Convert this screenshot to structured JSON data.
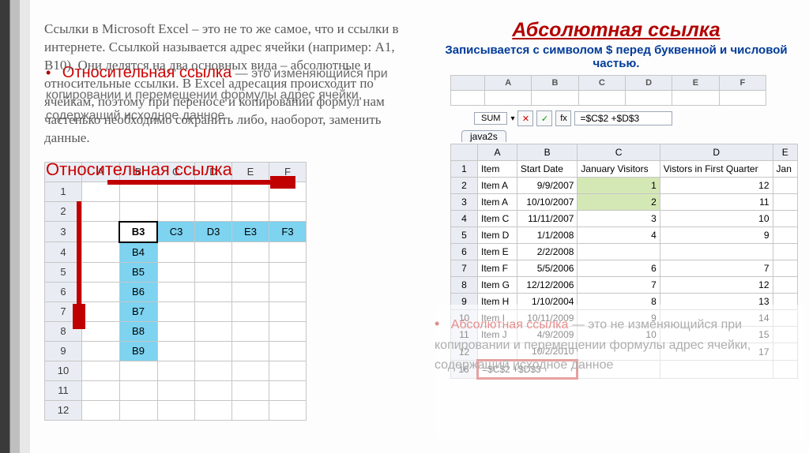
{
  "left": {
    "paragraph": "Ссылки в Microsoft Excel – это не то же самое, что и ссылки в интернете. Ссылкой называется адрес ячейки (например: А1, В10). Они делятся на два основных вида – абсолютные и относительные ссылки. В Excel адресация происходит по ячейкам, поэтому при переносе и копировании формул нам частенько необходимо сохранить либо, наоборот, заменить данные.",
    "ghost_heading": "Относительная ссылка",
    "ghost_item_title": "Относительная ссылка",
    "ghost_body": " — это изменяющийся при копировании и перемещении формулы адрес ячейки, содержащий исходное данное",
    "table": {
      "cols": [
        "",
        "A",
        "B",
        "C",
        "D",
        "E",
        "F"
      ],
      "rows": [
        {
          "n": "1",
          "cells": [
            "",
            "",
            "",
            "",
            "",
            ""
          ]
        },
        {
          "n": "2",
          "cells": [
            "",
            "",
            "",
            "",
            "",
            ""
          ]
        },
        {
          "n": "3",
          "cells": [
            "",
            "B3",
            "C3",
            "D3",
            "E3",
            "F3"
          ]
        },
        {
          "n": "4",
          "cells": [
            "",
            "B4",
            "",
            "",
            "",
            ""
          ]
        },
        {
          "n": "5",
          "cells": [
            "",
            "B5",
            "",
            "",
            "",
            ""
          ]
        },
        {
          "n": "6",
          "cells": [
            "",
            "B6",
            "",
            "",
            "",
            ""
          ]
        },
        {
          "n": "7",
          "cells": [
            "",
            "B7",
            "",
            "",
            "",
            ""
          ]
        },
        {
          "n": "8",
          "cells": [
            "",
            "B8",
            "",
            "",
            "",
            ""
          ]
        },
        {
          "n": "9",
          "cells": [
            "",
            "B9",
            "",
            "",
            "",
            ""
          ]
        },
        {
          "n": "10",
          "cells": [
            "",
            "",
            "",
            "",
            "",
            ""
          ]
        },
        {
          "n": "11",
          "cells": [
            "",
            "",
            "",
            "",
            "",
            ""
          ]
        },
        {
          "n": "12",
          "cells": [
            "",
            "",
            "",
            "",
            "",
            ""
          ]
        }
      ]
    }
  },
  "right": {
    "title": "Абсолютная ссылка",
    "subtitle": "Записывается с символом $ перед буквенной и числовой частью.",
    "mini_cols": [
      "",
      "A",
      "B",
      "C",
      "D",
      "E",
      "F"
    ],
    "namebox": "SUM",
    "fx_label": "fx",
    "formula": "=$C$2 +$D$3",
    "sheet_tab": "java2s",
    "data_cols": [
      "",
      "A",
      "B",
      "C",
      "D",
      "E"
    ],
    "headers": [
      "Item",
      "Start Date",
      "January Visitors",
      "Vistors in First Quarter",
      "Jan"
    ],
    "rows": [
      {
        "n": "2",
        "a": "Item A",
        "b": "9/9/2007",
        "c": "1",
        "d": "12"
      },
      {
        "n": "3",
        "a": "Item A",
        "b": "10/10/2007",
        "c": "2",
        "d": "11"
      },
      {
        "n": "4",
        "a": "Item C",
        "b": "11/11/2007",
        "c": "3",
        "d": "10"
      },
      {
        "n": "5",
        "a": "Item D",
        "b": "1/1/2008",
        "c": "4",
        "d": "9"
      },
      {
        "n": "6",
        "a": "Item E",
        "b": "2/2/2008",
        "c": "",
        "d": ""
      },
      {
        "n": "7",
        "a": "Item F",
        "b": "5/5/2006",
        "c": "6",
        "d": "7"
      },
      {
        "n": "8",
        "a": "Item G",
        "b": "12/12/2006",
        "c": "7",
        "d": "12"
      },
      {
        "n": "9",
        "a": "Item H",
        "b": "1/10/2004",
        "c": "8",
        "d": "13"
      },
      {
        "n": "10",
        "a": "Item I",
        "b": "10/11/2009",
        "c": "9",
        "d": "14"
      },
      {
        "n": "11",
        "a": "Item J",
        "b": "4/9/2009",
        "c": "10",
        "d": "15"
      },
      {
        "n": "12",
        "a": "",
        "b": "10/2/2010",
        "c": "",
        "d": "17"
      }
    ],
    "formula_row_n": "16",
    "formula_cell": "=$C$2 +$D$3",
    "ghost_item_title": "Абсолютная ссылка",
    "ghost_body": " — это не изменяющийся при копировании и перемещении формулы адрес ячейки, содержащий исходное данное"
  }
}
